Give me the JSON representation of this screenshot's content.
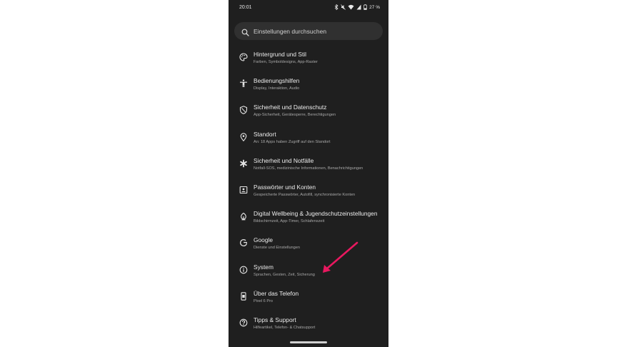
{
  "status_bar": {
    "time": "20:01",
    "battery": "27 %",
    "icons": [
      "bluetooth-icon",
      "mute-icon",
      "wifi-icon",
      "signal-icon",
      "battery-icon"
    ]
  },
  "search": {
    "icon": "search-icon",
    "placeholder": "Einstellungen durchsuchen"
  },
  "settings": [
    {
      "icon": "palette-icon",
      "title": "Hintergrund und Stil",
      "subtitle": "Farben, Symboldesigns, App-Raster"
    },
    {
      "icon": "accessibility-icon",
      "title": "Bedienungshilfen",
      "subtitle": "Display, Interaktion, Audio"
    },
    {
      "icon": "shield-icon",
      "title": "Sicherheit und Datenschutz",
      "subtitle": "App-Sicherheit, Gerätesperre, Berechtigungen"
    },
    {
      "icon": "location-icon",
      "title": "Standort",
      "subtitle": "An: 18 Apps haben Zugriff auf den Standort"
    },
    {
      "icon": "asterisk-icon",
      "title": "Sicherheit und Notfälle",
      "subtitle": "Notfall-SOS, medizinische Informationen, Benachrichtigungen"
    },
    {
      "icon": "account-card-icon",
      "title": "Passwörter und Konten",
      "subtitle": "Gespeicherte Passwörter, Autofill, synchronisierte Konten"
    },
    {
      "icon": "wellbeing-icon",
      "title": "Digital Wellbeing & Jugendschutzeinstellungen",
      "subtitle": "Bildschirmzeit, App-Timer, Schlafenszeit"
    },
    {
      "icon": "google-icon",
      "title": "Google",
      "subtitle": "Dienste und Einstellungen"
    },
    {
      "icon": "info-icon",
      "title": "System",
      "subtitle": "Sprachen, Gesten, Zeit, Sicherung"
    },
    {
      "icon": "phone-icon",
      "title": "Über das Telefon",
      "subtitle": "Pixel 6 Pro"
    },
    {
      "icon": "help-icon",
      "title": "Tipps & Support",
      "subtitle": "Hilfeartikel, Telefon- & Chatsupport"
    }
  ],
  "annotation": {
    "icon": "arrow-annotation",
    "color": "#e8185f"
  },
  "colors": {
    "background": "#1f1f1f",
    "search_bg": "#303030",
    "text": "#ececec",
    "subtext": "#a8a8a8"
  }
}
